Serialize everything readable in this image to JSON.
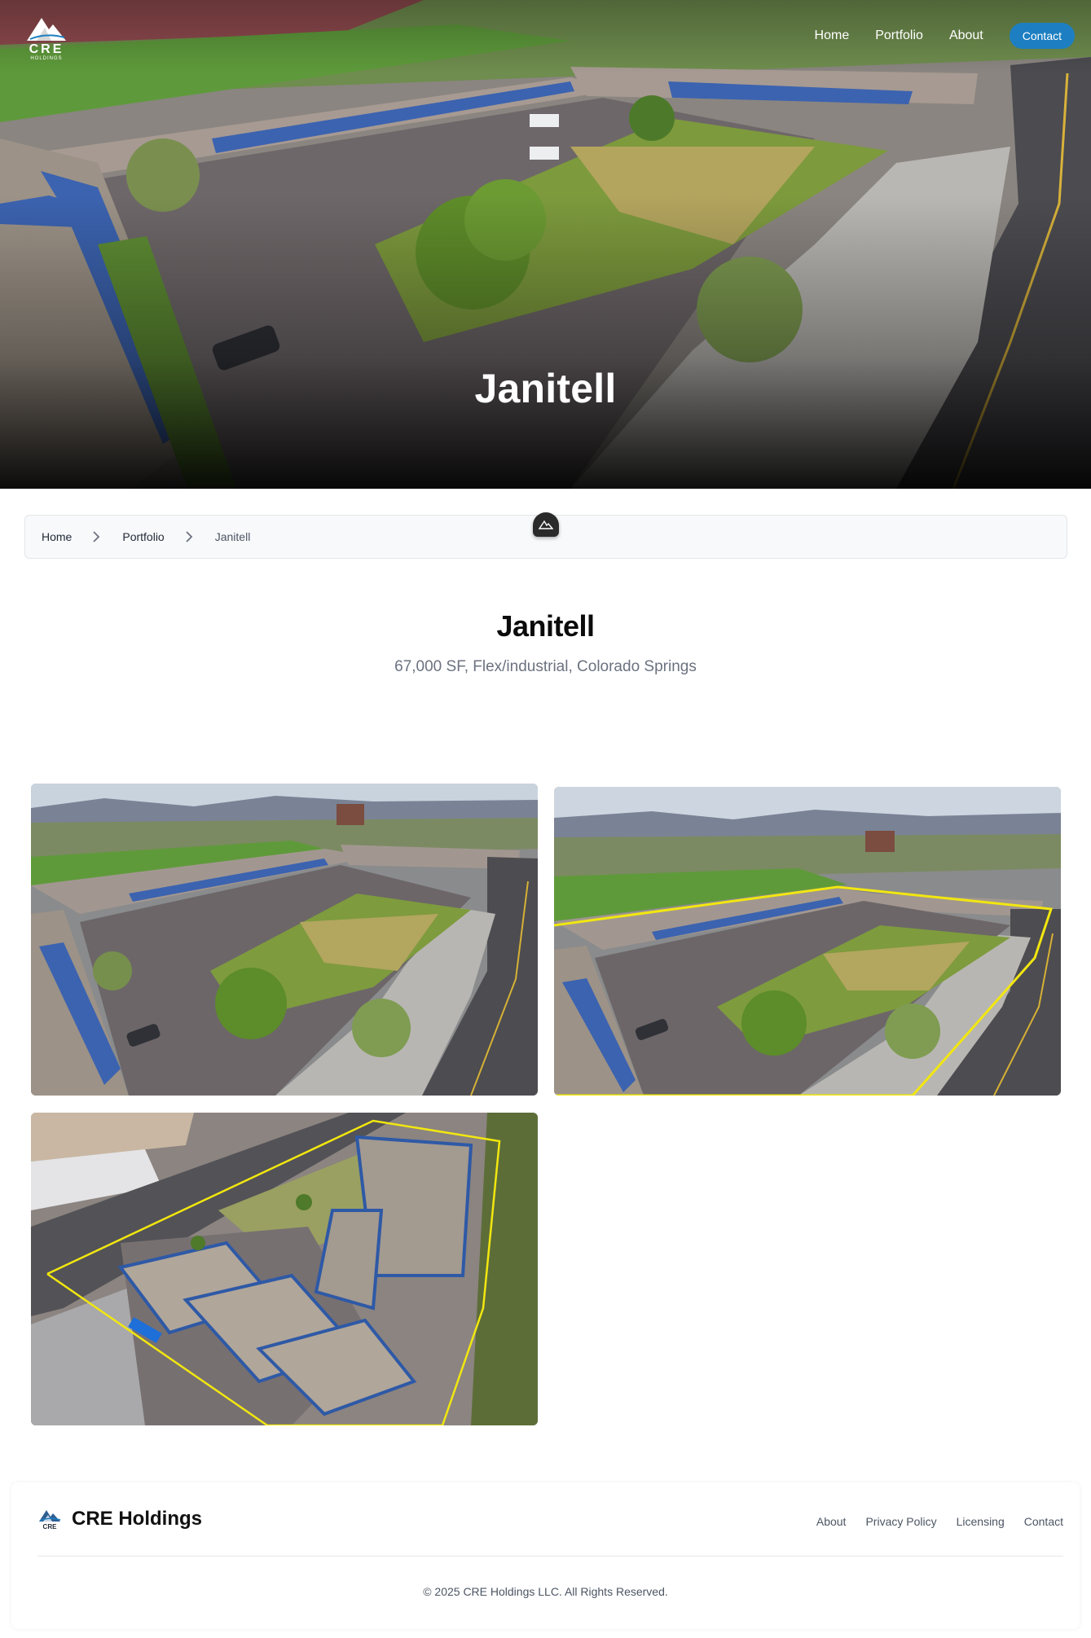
{
  "colors": {
    "accent": "#1d7fc1",
    "page_title": "#0b0b0b",
    "subtitle": "#6b7280",
    "property_outline": "#f2e70f",
    "roof_blue": "#3c63b0"
  },
  "brand": {
    "logo_letters": "CRE",
    "logo_subtext": "HOLDINGS",
    "name": "CRE Holdings",
    "icon": "mountain-logo-icon"
  },
  "nav": {
    "home": "Home",
    "portfolio": "Portfolio",
    "about": "About",
    "contact": "Contact"
  },
  "hero": {
    "title": "Janitell"
  },
  "breadcrumb": {
    "items": [
      "Home",
      "Portfolio",
      "Janitell"
    ],
    "separator_icon": "chevron-right-icon"
  },
  "property": {
    "title": "Janitell",
    "summary": "67,000 SF, Flex/industrial, Colorado Springs"
  },
  "gallery": {
    "count": 3,
    "photos": [
      {
        "view": "aerial oblique",
        "outline": false
      },
      {
        "view": "aerial oblique",
        "outline": true
      },
      {
        "view": "aerial overhead",
        "outline": true
      }
    ]
  },
  "footer": {
    "links": [
      "About",
      "Privacy Policy",
      "Licensing",
      "Contact"
    ],
    "copyright": "© 2025 CRE Holdings LLC. All Rights Reserved."
  }
}
